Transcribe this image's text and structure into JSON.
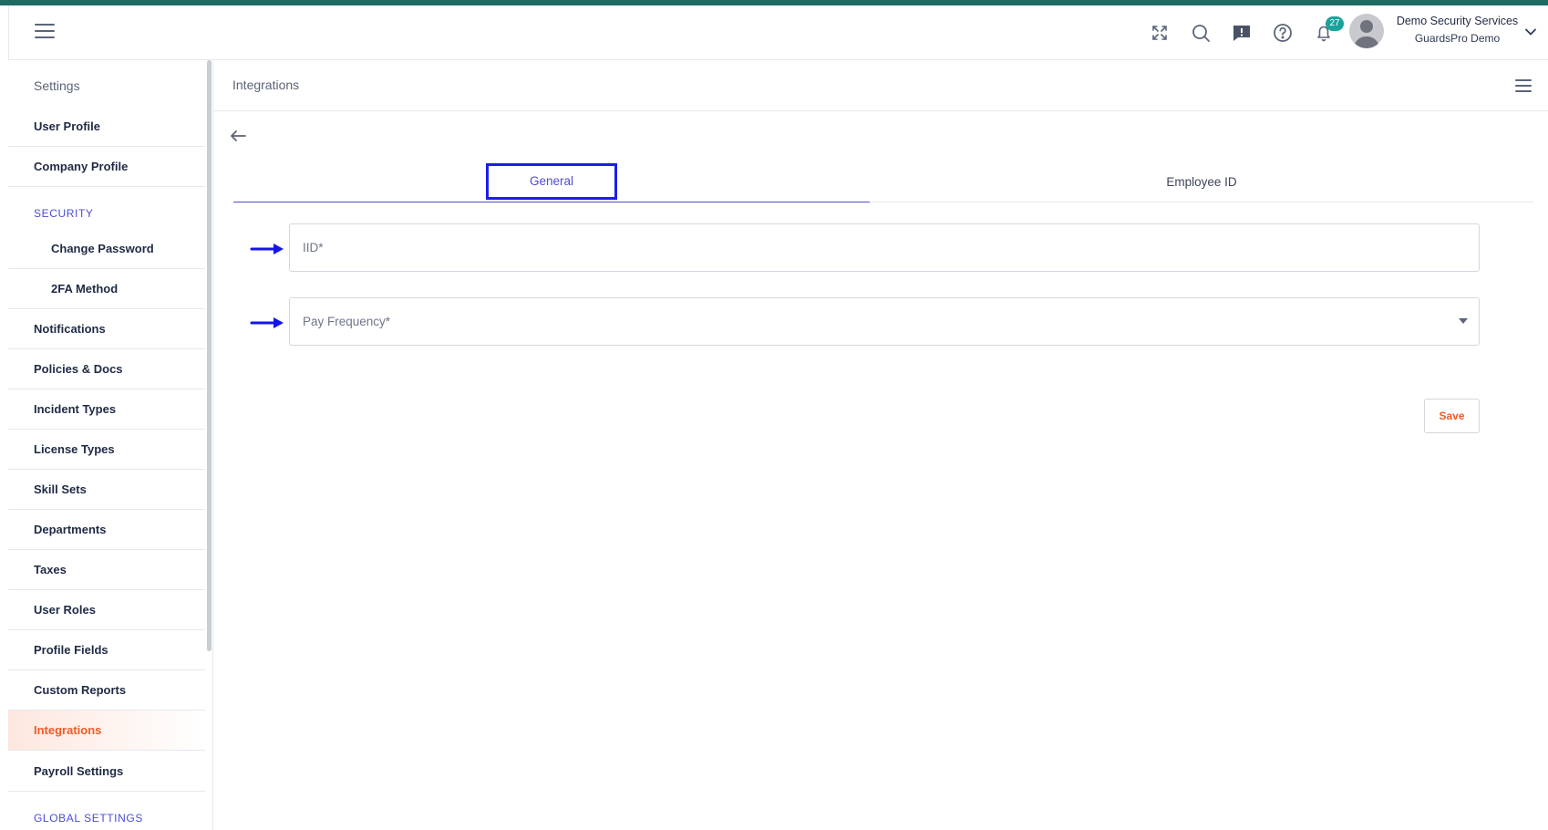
{
  "header": {
    "user_name": "Demo Security Services",
    "user_company": "GuardsPro Demo",
    "notification_count": "27",
    "icons": [
      "fullscreen-icon",
      "search-icon",
      "feedback-icon",
      "help-icon",
      "bell-icon"
    ]
  },
  "sidebar": {
    "title": "Settings",
    "items": {
      "user_profile": "User Profile",
      "company_profile": "Company Profile",
      "security_section": "SECURITY",
      "change_password": "Change Password",
      "twofa": "2FA Method",
      "notifications": "Notifications",
      "policies": "Policies & Docs",
      "incident_types": "Incident Types",
      "license_types": "License Types",
      "skill_sets": "Skill Sets",
      "departments": "Departments",
      "taxes": "Taxes",
      "user_roles": "User Roles",
      "profile_fields": "Profile Fields",
      "custom_reports": "Custom Reports",
      "integrations": "Integrations",
      "payroll_settings": "Payroll Settings",
      "global_section": "GLOBAL SETTINGS"
    },
    "active_item": "Integrations"
  },
  "page": {
    "title": "Integrations",
    "tabs": {
      "general": "General",
      "employee_id": "Employee ID"
    },
    "active_tab": "General",
    "fields": {
      "iid_placeholder": "IID*",
      "pay_frequency_placeholder": "Pay Frequency*"
    },
    "save_label": "Save"
  },
  "colors": {
    "accent": "#4c4cd9",
    "active": "#f05b26",
    "highlight_box": "#1d1df0",
    "top_strip": "#1f6b63",
    "badge": "#1aa39a"
  }
}
